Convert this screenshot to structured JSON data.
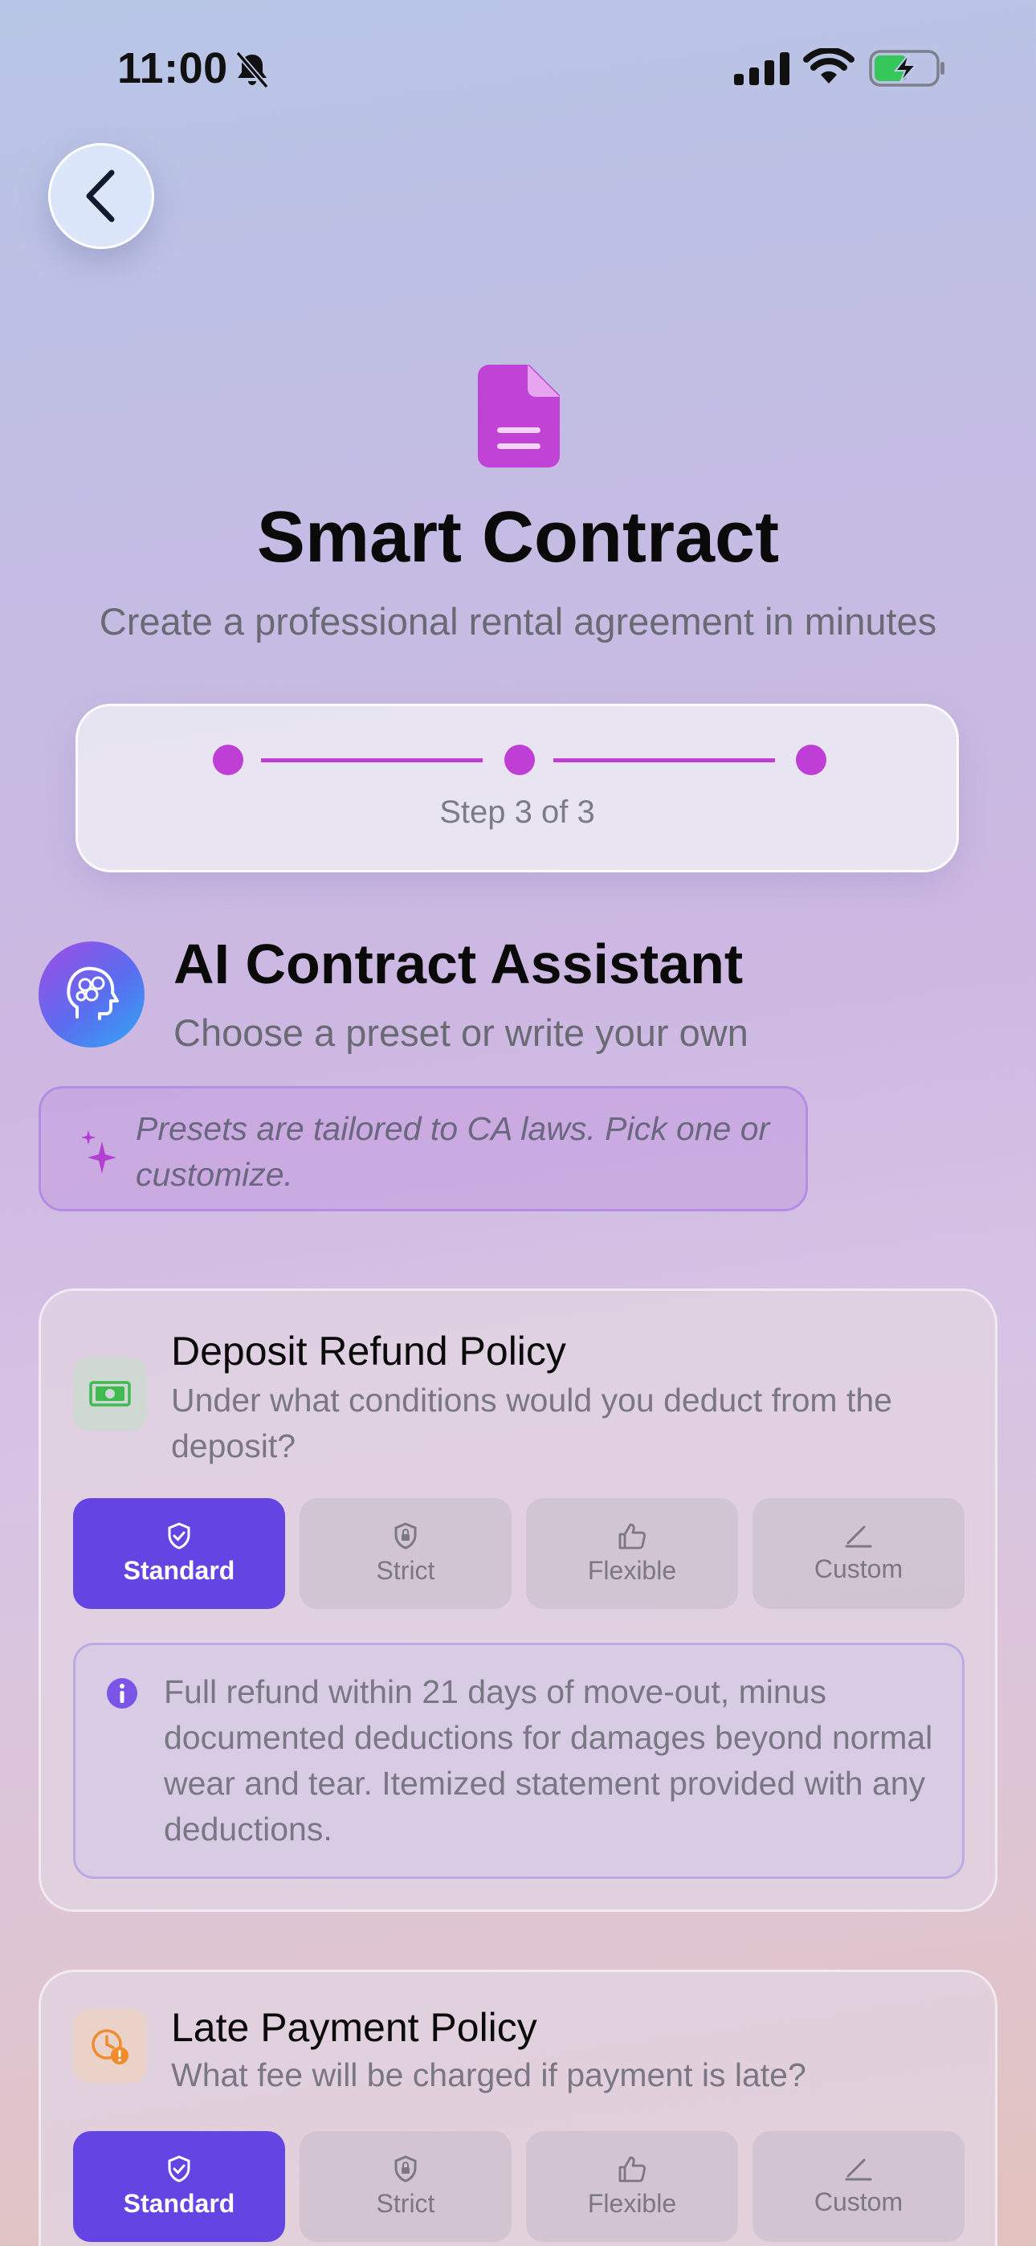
{
  "status_bar": {
    "time": "11:00"
  },
  "header": {
    "title": "Smart Contract",
    "subtitle": "Create a professional rental agreement in minutes"
  },
  "progress": {
    "current_step": 3,
    "total_steps": 3,
    "label": "Step 3 of 3"
  },
  "assistant": {
    "title": "AI Contract Assistant",
    "subtitle": "Choose a preset or write your own",
    "hint": "Presets are tailored to CA laws. Pick one or customize."
  },
  "policies": [
    {
      "title": "Deposit Refund Policy",
      "question": "Under what conditions would you deduct from the deposit?",
      "icon": "money-icon",
      "icon_color": "#3fb950",
      "options": [
        "Standard",
        "Strict",
        "Flexible",
        "Custom"
      ],
      "selected": "Standard",
      "description": "Full refund within 21 days of move-out, minus documented deductions for damages beyond normal wear and tear. Itemized statement provided with any deductions."
    },
    {
      "title": "Late Payment Policy",
      "question": "What fee will be charged if payment is late?",
      "icon": "clock-alert-icon",
      "icon_color": "#f28a2e",
      "options": [
        "Standard",
        "Strict",
        "Flexible",
        "Custom"
      ],
      "selected": "Standard"
    }
  ],
  "colors": {
    "accent": "#bf3fd6",
    "selected_option": "#6444e3"
  }
}
